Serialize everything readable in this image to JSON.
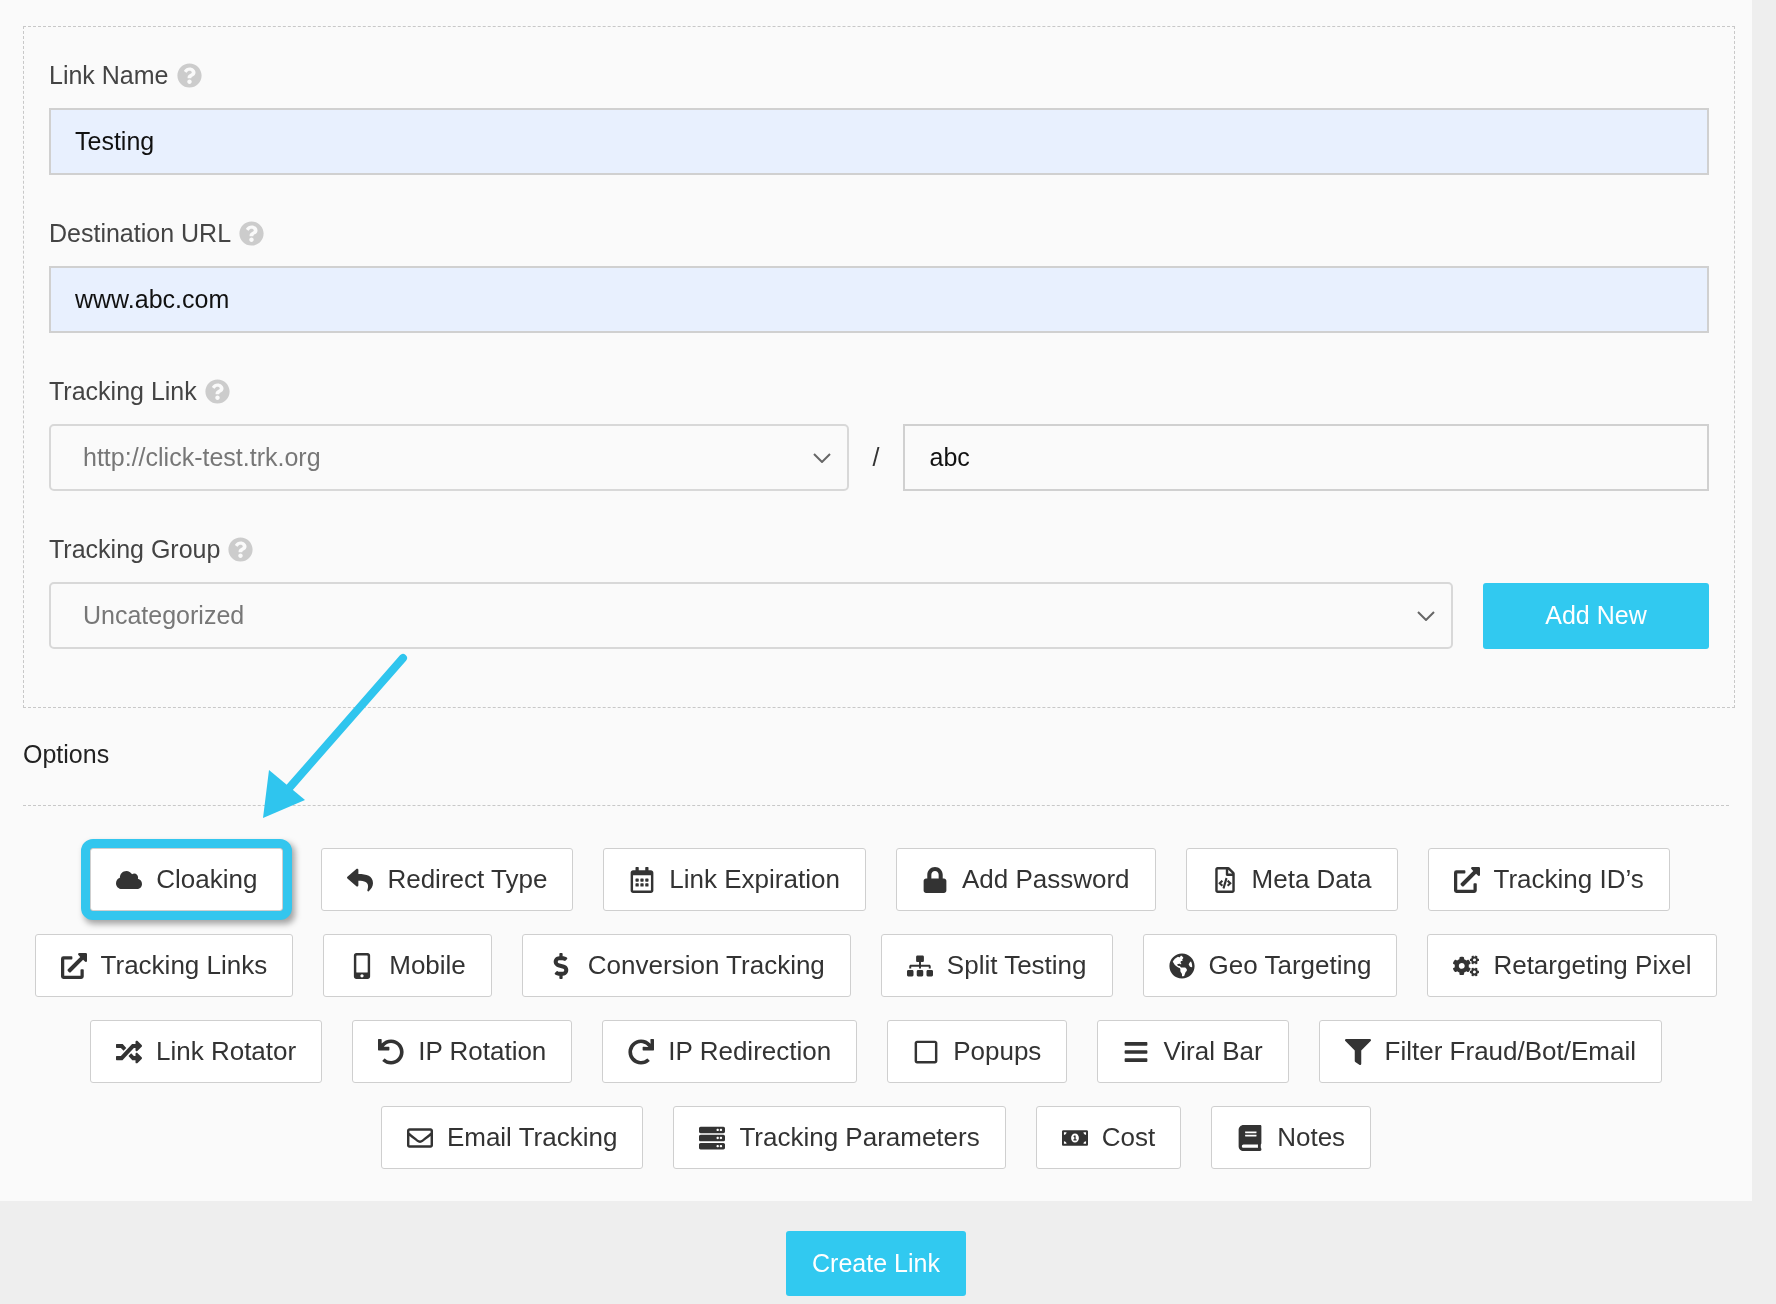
{
  "form": {
    "fields": [
      {
        "kind": "text",
        "label": "Link Name",
        "value": "Testing"
      },
      {
        "kind": "text",
        "label": "Destination URL",
        "value": "www.abc.com"
      },
      {
        "kind": "split",
        "label": "Tracking Link",
        "select_value": "http://click-test.trk.org",
        "separator": "/",
        "value": "abc"
      },
      {
        "kind": "group",
        "label": "Tracking Group",
        "select_value": "Uncategorized",
        "button": "Add New"
      }
    ]
  },
  "options": {
    "label": "Options",
    "items": [
      {
        "label": "Cloaking",
        "highlighted": true
      },
      {
        "label": "Redirect Type",
        "highlighted": false
      },
      {
        "label": "Link Expiration",
        "highlighted": false
      },
      {
        "label": "Add Password",
        "highlighted": false
      },
      {
        "label": "Meta Data",
        "highlighted": false
      },
      {
        "label": "Tracking ID’s",
        "highlighted": false
      },
      {
        "label": "Tracking Links",
        "highlighted": false
      },
      {
        "label": "Mobile",
        "highlighted": false
      },
      {
        "label": "Conversion Tracking",
        "highlighted": false
      },
      {
        "label": "Split Testing",
        "highlighted": false
      },
      {
        "label": "Geo Targeting",
        "highlighted": false
      },
      {
        "label": "Retargeting Pixel",
        "highlighted": false
      },
      {
        "label": "Link Rotator",
        "highlighted": false
      },
      {
        "label": "IP Rotation",
        "highlighted": false
      },
      {
        "label": "IP Redirection",
        "highlighted": false
      },
      {
        "label": "Popups",
        "highlighted": false
      },
      {
        "label": "Viral Bar",
        "highlighted": false
      },
      {
        "label": "Filter Fraud/Bot/Email",
        "highlighted": false
      },
      {
        "label": "Email Tracking",
        "highlighted": false
      },
      {
        "label": "Tracking Parameters",
        "highlighted": false
      },
      {
        "label": "Cost",
        "highlighted": false
      },
      {
        "label": "Notes",
        "highlighted": false
      }
    ]
  },
  "submit": "Create Link"
}
